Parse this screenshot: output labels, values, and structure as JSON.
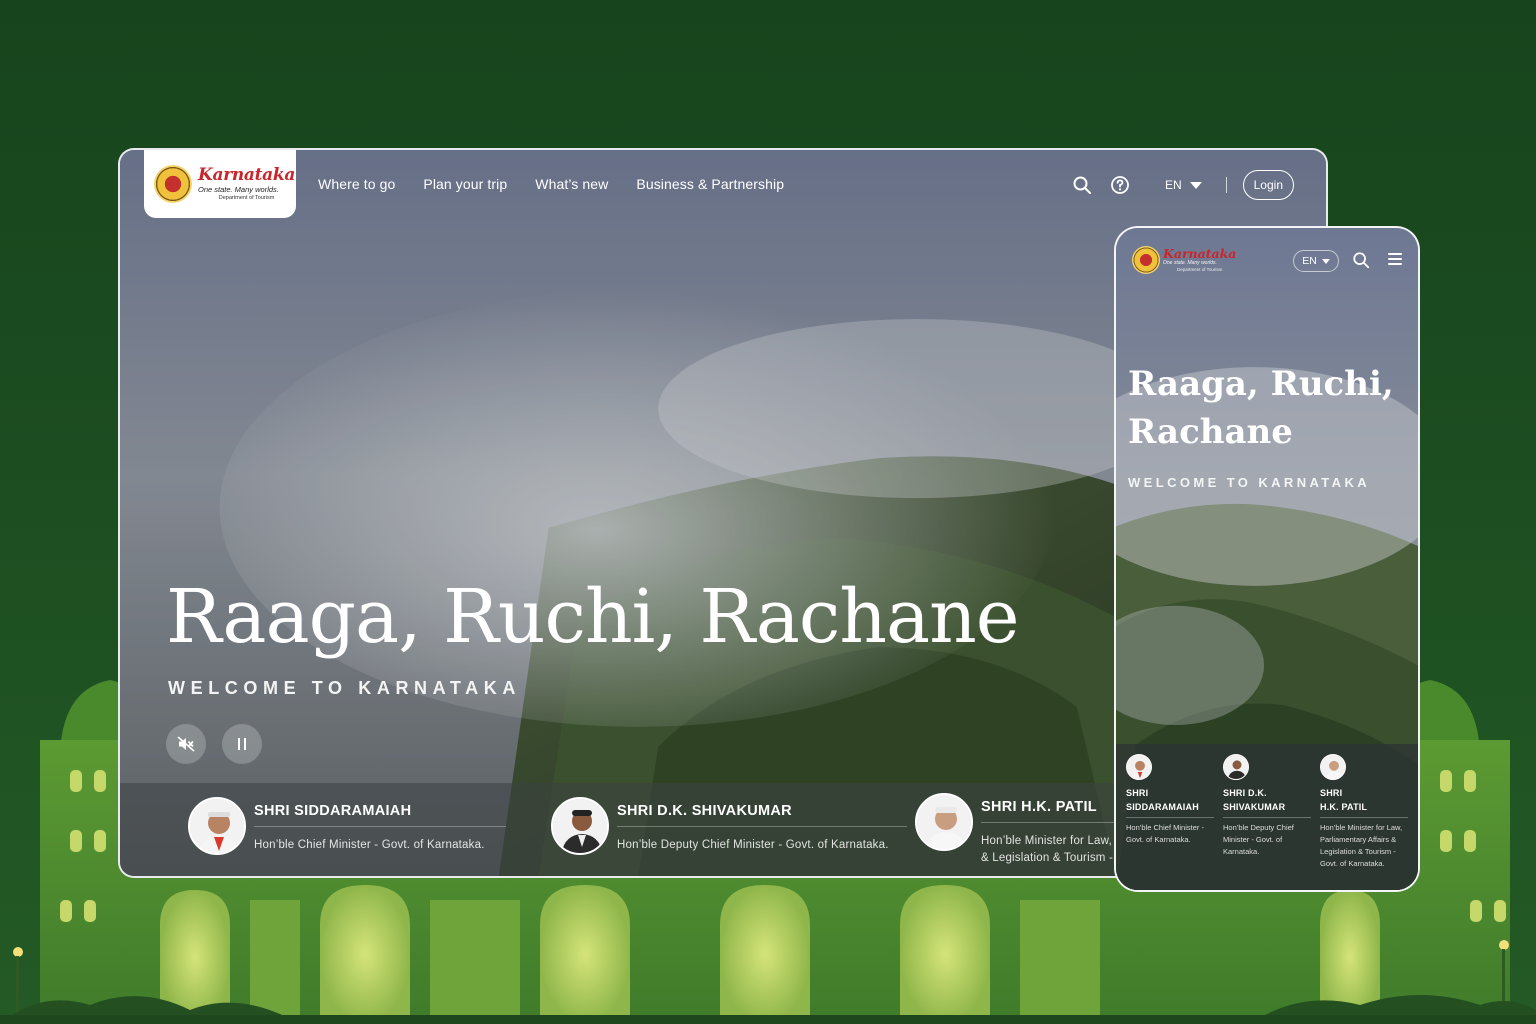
{
  "brand": {
    "name": "Karnataka",
    "tagline": "One state. Many worlds.",
    "department": "Department of Tourism"
  },
  "nav": {
    "items": [
      "Where to go",
      "Plan your trip",
      "What’s new",
      "Business & Partnership"
    ]
  },
  "header": {
    "language": "EN",
    "login_label": "Login"
  },
  "hero": {
    "title": "Raaga, Ruchi, Rachane",
    "mobile_title_line1": "Raaga, Ruchi,",
    "mobile_title_line2": "Rachane",
    "subtitle": "WELCOME TO KARNATAKA"
  },
  "leaders": [
    {
      "name": "SHRI SIDDARAMAIAH",
      "role": "Hon’ble Chief Minister - Govt. of Karnataka.",
      "mobile_name_line1": "SHRI",
      "mobile_name_line2": "SIDDARAMAIAH",
      "mobile_role": "Hon’ble Chief Minister - Govt. of Karnataka."
    },
    {
      "name": "SHRI D.K. SHIVAKUMAR",
      "role": "Hon’ble Deputy Chief Minister - Govt. of Karnataka.",
      "mobile_name_line1": "SHRI D.K.",
      "mobile_name_line2": "SHIVAKUMAR",
      "mobile_role": "Hon’ble Deputy Chief Minister - Govt. of Karnataka."
    },
    {
      "name": "SHRI H.K. PATIL",
      "role_line1": "Hon’ble Minister for Law,",
      "role_line2": "& Legislation & Tourism -",
      "mobile_name_line1": "SHRI",
      "mobile_name_line2": "H.K. PATIL",
      "mobile_role": "Hon’ble Minister for Law, Parliamentary Affairs & Legislation & Tourism - Govt. of Karnataka."
    }
  ],
  "icons": {
    "search": "search-icon",
    "help": "help-icon",
    "mute": "mute-icon",
    "pause": "pause-icon",
    "menu": "menu-icon"
  },
  "colors": {
    "background": "#1c4d21",
    "palace": "#4f8a2f",
    "palace_light": "#a3c94a",
    "brand_red": "#c9262c"
  }
}
